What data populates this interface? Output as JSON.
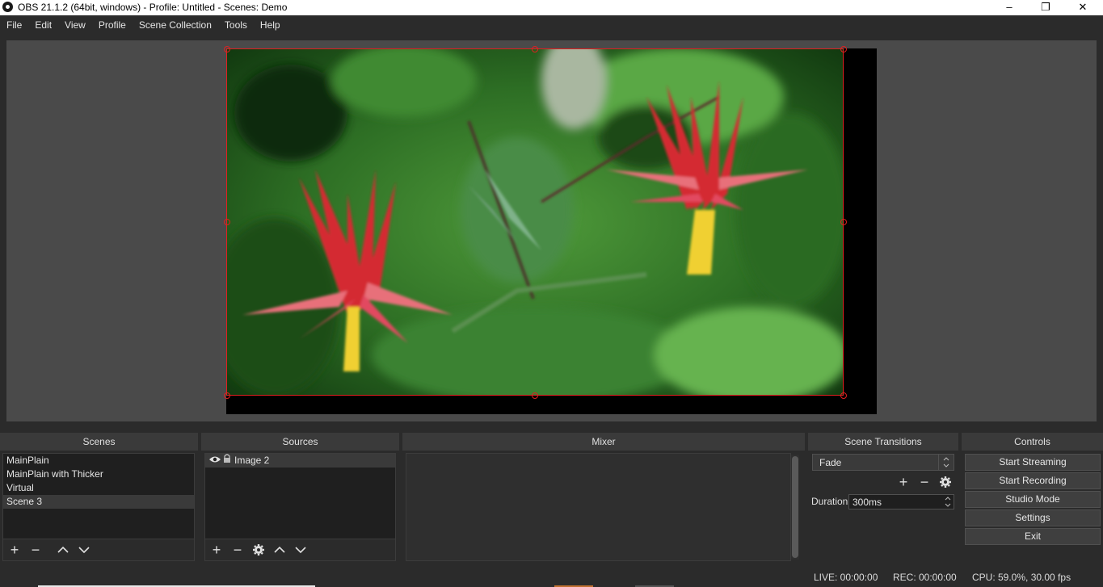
{
  "window": {
    "title": "OBS 21.1.2 (64bit, windows) - Profile: Untitled - Scenes: Demo",
    "minimize": "–",
    "maximize": "❐",
    "close": "✕"
  },
  "menu": [
    "File",
    "Edit",
    "View",
    "Profile",
    "Scene Collection",
    "Tools",
    "Help"
  ],
  "docks": {
    "scenes": {
      "title": "Scenes",
      "items": [
        "MainPlain",
        "MainPlain with Thicker",
        "Virtual",
        "Scene 3"
      ],
      "selected": "Scene 3"
    },
    "sources": {
      "title": "Sources",
      "items": [
        {
          "name": "Image 2",
          "visible": true,
          "locked": true
        }
      ]
    },
    "mixer": {
      "title": "Mixer"
    },
    "transitions": {
      "title": "Scene Transitions",
      "selected": "Fade",
      "duration_label": "Duration",
      "duration_value": "300ms"
    },
    "controls": {
      "title": "Controls",
      "buttons": [
        "Start Streaming",
        "Start Recording",
        "Studio Mode",
        "Settings",
        "Exit"
      ]
    }
  },
  "status": {
    "live": "LIVE: 00:00:00",
    "rec": "REC: 00:00:00",
    "cpu": "CPU: 59.0%, 30.00 fps"
  },
  "icons": {
    "add": "plus-icon",
    "remove": "minus-icon",
    "up": "chevron-up-icon",
    "down": "chevron-down-icon",
    "settings": "gear-icon",
    "visibility": "eye-icon",
    "lock": "lock-icon"
  },
  "colors": {
    "selection": "#e02020",
    "background": "#2b2b2b",
    "preview_bg": "#4a4a4a"
  }
}
